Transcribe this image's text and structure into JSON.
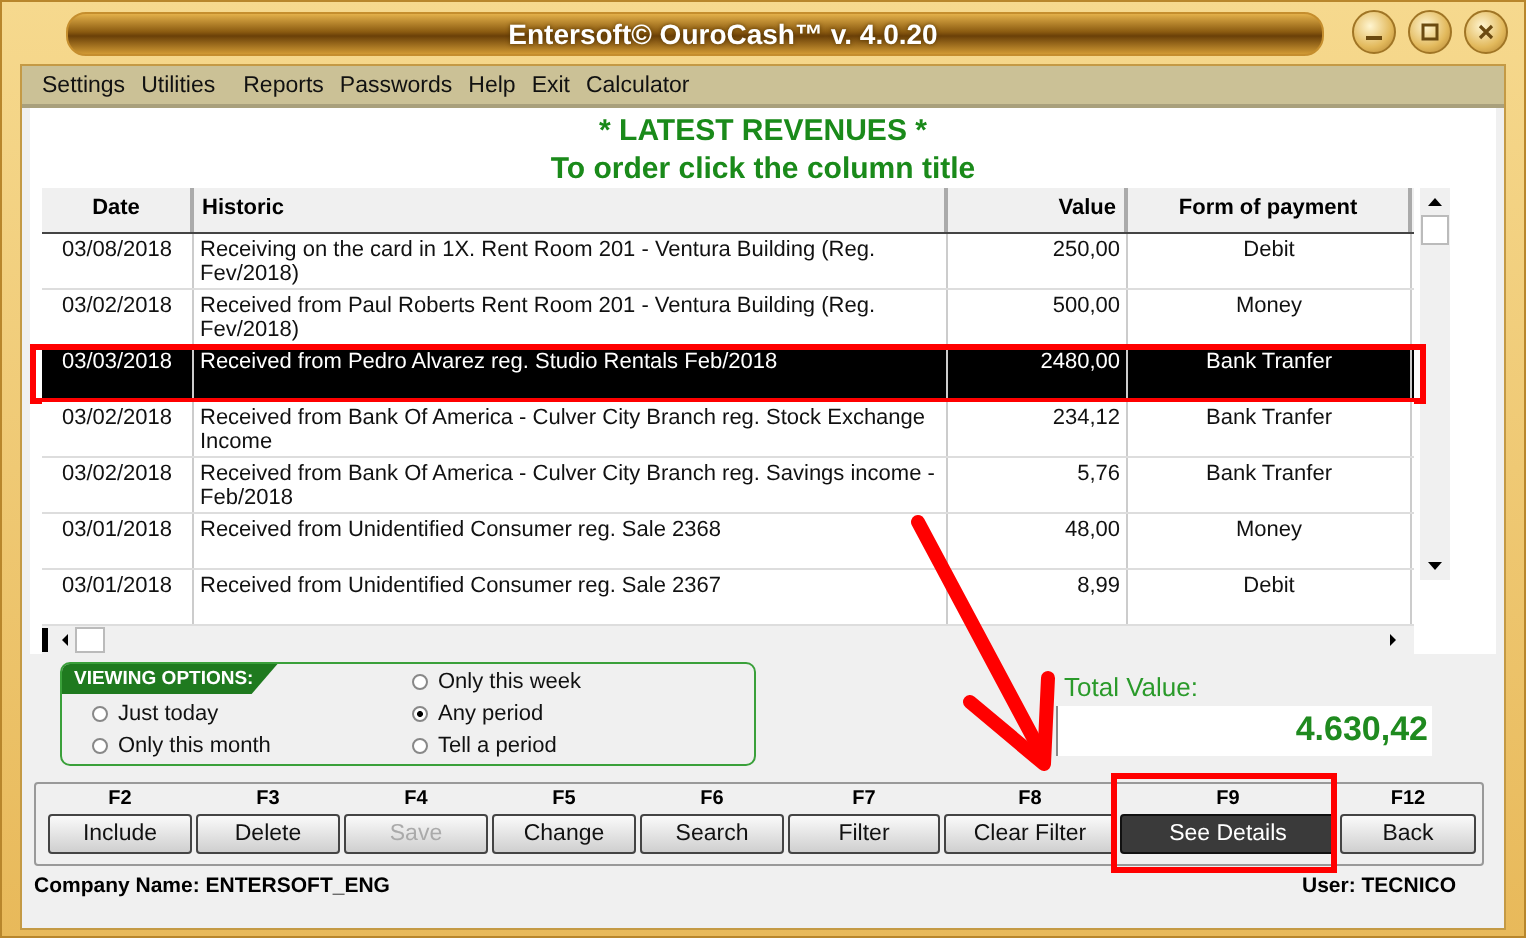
{
  "window": {
    "title": "Entersoft© OuroCash™ v. 4.0.20"
  },
  "menu": [
    {
      "label": "Settings"
    },
    {
      "label": "Utilities"
    },
    {
      "label": "Reports"
    },
    {
      "label": "Passwords"
    },
    {
      "label": "Help"
    },
    {
      "label": "Exit"
    },
    {
      "label": "Calculator"
    }
  ],
  "heading": "* LATEST REVENUES *",
  "subheading": "To order click the column title",
  "table": {
    "columns": [
      {
        "label": "Date"
      },
      {
        "label": "Historic"
      },
      {
        "label": "Value"
      },
      {
        "label": "Form of payment"
      }
    ],
    "rows": [
      {
        "cells": [
          "03/08/2018",
          "Receiving on the card in 1X. Rent Room 201 - Ventura Building (Reg. Fev/2018)",
          "250,00",
          "Debit"
        ],
        "selected": false
      },
      {
        "cells": [
          "03/02/2018",
          "Received from Paul Roberts Rent Room 201 - Ventura Building (Reg. Fev/2018)",
          "500,00",
          "Money"
        ],
        "selected": false
      },
      {
        "cells": [
          "03/03/2018",
          "Received from Pedro Alvarez reg. Studio Rentals Feb/2018",
          "2480,00",
          "Bank Tranfer"
        ],
        "selected": true
      },
      {
        "cells": [
          "03/02/2018",
          "Received from Bank Of America - Culver City Branch reg. Stock Exchange Income",
          "234,12",
          "Bank Tranfer"
        ],
        "selected": false
      },
      {
        "cells": [
          "03/02/2018",
          "Received from Bank Of America - Culver City Branch reg. Savings income - Feb/2018",
          "5,76",
          "Bank Tranfer"
        ],
        "selected": false
      },
      {
        "cells": [
          "03/01/2018",
          "Received from Unidentified Consumer reg. Sale 2368",
          "48,00",
          "Money"
        ],
        "selected": false
      },
      {
        "cells": [
          "03/01/2018",
          "Received from Unidentified Consumer reg. Sale 2367",
          "8,99",
          "Debit"
        ],
        "selected": false
      }
    ]
  },
  "viewing_options": {
    "title": "VIEWING OPTIONS:",
    "groups": [
      [
        {
          "label": "Just today",
          "selected": false
        },
        {
          "label": "Only this month",
          "selected": false
        }
      ],
      [
        {
          "label": "Only this week",
          "selected": false
        },
        {
          "label": "Any period",
          "selected": true
        },
        {
          "label": "Tell a period",
          "selected": false
        }
      ]
    ]
  },
  "total": {
    "label": "Total Value:",
    "value": "4.630,42"
  },
  "buttons": [
    {
      "key": "F2",
      "label": "Include",
      "disabled": false,
      "selected": false
    },
    {
      "key": "F3",
      "label": "Delete",
      "disabled": false,
      "selected": false
    },
    {
      "key": "F4",
      "label": "Save",
      "disabled": true,
      "selected": false
    },
    {
      "key": "F5",
      "label": "Change",
      "disabled": false,
      "selected": false
    },
    {
      "key": "F6",
      "label": "Search",
      "disabled": false,
      "selected": false
    },
    {
      "key": "F7",
      "label": "Filter",
      "disabled": false,
      "selected": false
    },
    {
      "key": "F8",
      "label": "Clear Filter",
      "disabled": false,
      "selected": false
    },
    {
      "key": "F9",
      "label": "See Details",
      "disabled": false,
      "selected": true
    },
    {
      "key": "F12",
      "label": "Back",
      "disabled": false,
      "selected": false
    }
  ],
  "status_bar": {
    "company": "Company Name: ENTERSOFT_ENG",
    "user": "User: TECNICO"
  }
}
